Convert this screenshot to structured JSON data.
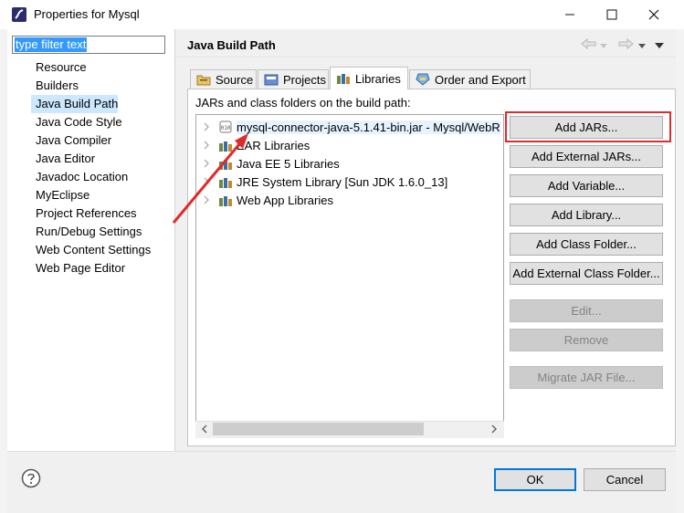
{
  "window": {
    "title": "Properties for Mysql"
  },
  "filter": {
    "value": "type filter text"
  },
  "nav": {
    "items": [
      {
        "label": "Resource"
      },
      {
        "label": "Builders"
      },
      {
        "label": "Java Build Path",
        "selected": true
      },
      {
        "label": "Java Code Style"
      },
      {
        "label": "Java Compiler"
      },
      {
        "label": "Java Editor"
      },
      {
        "label": "Javadoc Location"
      },
      {
        "label": "MyEclipse"
      },
      {
        "label": "Project References"
      },
      {
        "label": "Run/Debug Settings"
      },
      {
        "label": "Web Content Settings"
      },
      {
        "label": "Web Page Editor"
      }
    ]
  },
  "page": {
    "title": "Java Build Path"
  },
  "tabs": [
    {
      "label": "Source"
    },
    {
      "label": "Projects"
    },
    {
      "label": "Libraries",
      "active": true
    },
    {
      "label": "Order and Export"
    }
  ],
  "libraries": {
    "section_label": "JARs and class folders on the build path:",
    "entries": [
      {
        "label": "mysql-connector-java-5.1.41-bin.jar - Mysql/WebR",
        "icon": "jar-icon",
        "selected": true
      },
      {
        "label": "EAR Libraries",
        "icon": "library-icon"
      },
      {
        "label": "Java EE 5 Libraries",
        "icon": "library-icon"
      },
      {
        "label": "JRE System Library [Sun JDK 1.6.0_13]",
        "icon": "library-icon"
      },
      {
        "label": "Web App Libraries",
        "icon": "library-icon"
      }
    ]
  },
  "buttons": {
    "add_jars": "Add JARs...",
    "add_external_jars": "Add External JARs...",
    "add_variable": "Add Variable...",
    "add_library": "Add Library...",
    "add_class_folder": "Add Class Folder...",
    "add_external_class_folder": "Add External Class Folder...",
    "edit": "Edit...",
    "remove": "Remove",
    "migrate_jar": "Migrate JAR File..."
  },
  "dialog": {
    "ok": "OK",
    "cancel": "Cancel"
  },
  "colors": {
    "selection": "#cce8ff",
    "highlight_annotation": "#e02b2b",
    "default_button_border": "#0078d7"
  }
}
